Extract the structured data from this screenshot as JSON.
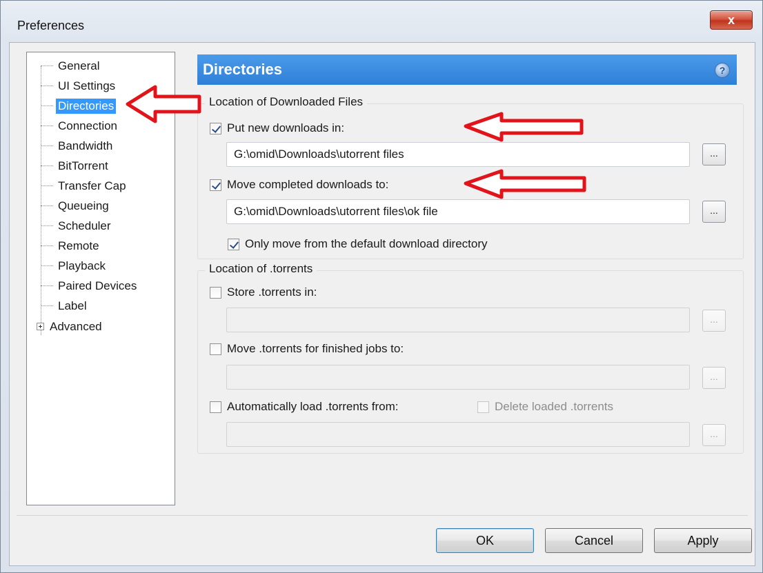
{
  "window": {
    "title": "Preferences",
    "close_label": "x"
  },
  "tree": {
    "items": [
      {
        "label": "General"
      },
      {
        "label": "UI Settings"
      },
      {
        "label": "Directories"
      },
      {
        "label": "Connection"
      },
      {
        "label": "Bandwidth"
      },
      {
        "label": "BitTorrent"
      },
      {
        "label": "Transfer Cap"
      },
      {
        "label": "Queueing"
      },
      {
        "label": "Scheduler"
      },
      {
        "label": "Remote"
      },
      {
        "label": "Playback"
      },
      {
        "label": "Paired Devices"
      },
      {
        "label": "Label"
      },
      {
        "label": "Advanced"
      }
    ],
    "selected": "Directories"
  },
  "panel": {
    "title": "Directories",
    "help_label": "?",
    "downloaded": {
      "group_title": "Location of Downloaded Files",
      "put_new_label": "Put new downloads in:",
      "put_new_checked": true,
      "put_new_path": "G:\\omid\\Downloads\\utorrent files",
      "move_completed_label": "Move completed downloads to:",
      "move_completed_checked": true,
      "move_completed_path": "G:\\omid\\Downloads\\utorrent files\\ok file",
      "only_move_label": "Only move from the default download directory",
      "only_move_checked": true
    },
    "torrents": {
      "group_title": "Location of .torrents",
      "store_label": "Store .torrents in:",
      "store_path": "",
      "move_finished_label": "Move .torrents for finished jobs to:",
      "move_finished_path": "",
      "autoload_label": "Automatically load .torrents from:",
      "autoload_path": "",
      "delete_loaded_label": "Delete loaded .torrents"
    },
    "browse_label": "..."
  },
  "buttons": {
    "ok": "OK",
    "cancel": "Cancel",
    "apply": "Apply"
  },
  "colors": {
    "header": "#3a8be0",
    "selection": "#3399ff",
    "annotation_arrow": "#e0141a"
  }
}
